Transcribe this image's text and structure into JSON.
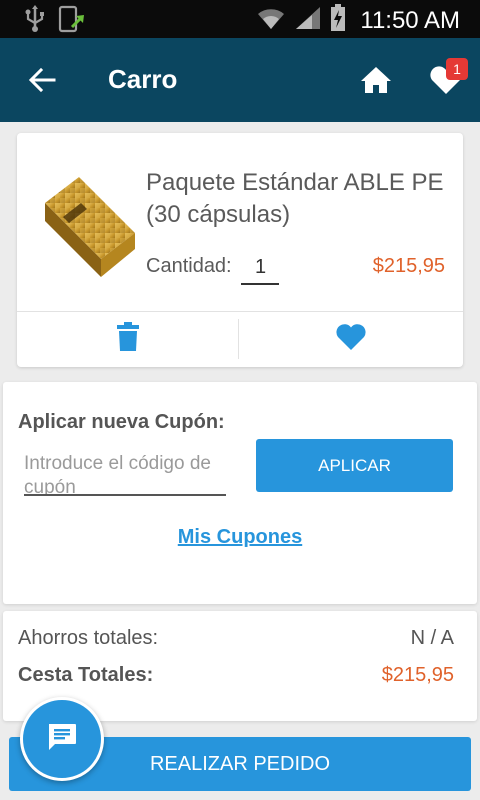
{
  "status_bar": {
    "time": "11:50 AM",
    "icons": [
      "usb-icon",
      "screenshot-icon",
      "wifi-icon",
      "signal-icon",
      "battery-charging-icon"
    ]
  },
  "app_bar": {
    "title": "Carro",
    "back_icon": "arrow-back-icon",
    "home_icon": "home-icon",
    "favorites_icon": "heart-icon",
    "favorites_badge": "1"
  },
  "cart_item": {
    "name": "Paquete Estándar ABLE PE (30 cápsulas)",
    "quantity_label": "Cantidad:",
    "quantity": "1",
    "price": "$215,95",
    "delete_icon": "trash-icon",
    "wishlist_icon": "heart-icon"
  },
  "coupon": {
    "title": "Aplicar nueva Cupón:",
    "input_placeholder": "Introduce el código de cupón",
    "apply_label": "APLICAR",
    "my_coupons_label": "Mis Cupones"
  },
  "totals": {
    "savings_label": "Ahorros totales:",
    "savings_value": "N / A",
    "total_label": "Cesta Totales:",
    "total_value": "$215,95"
  },
  "order_button_label": "REALIZAR PEDIDO",
  "chat_icon": "chat-icon",
  "colors": {
    "app_bar": "#0b4660",
    "accent_blue": "#2795dc",
    "price_orange": "#e0622b",
    "badge_red": "#e53935"
  }
}
